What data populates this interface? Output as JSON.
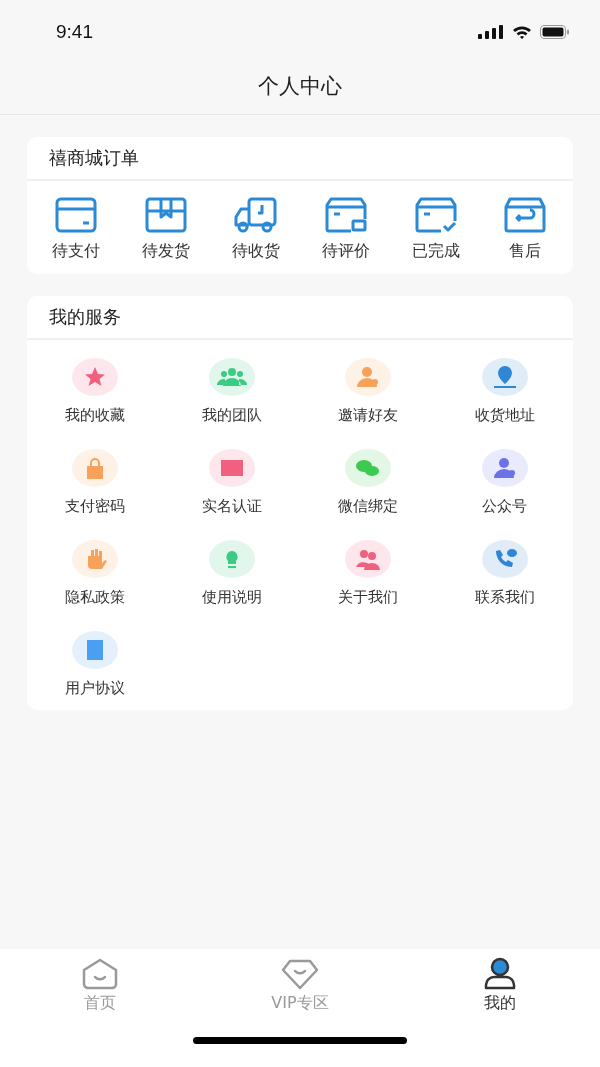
{
  "status_bar": {
    "time": "9:41"
  },
  "header": {
    "title": "个人中心"
  },
  "orders": {
    "title": "禧商城订单",
    "items": [
      {
        "label": "待支付"
      },
      {
        "label": "待发货"
      },
      {
        "label": "待收货"
      },
      {
        "label": "待评价"
      },
      {
        "label": "已完成"
      },
      {
        "label": "售后"
      }
    ]
  },
  "services": {
    "title": "我的服务",
    "items": [
      {
        "label": "我的收藏",
        "color": "#f0607f"
      },
      {
        "label": "我的团队",
        "color": "#3ccb82"
      },
      {
        "label": "邀请好友",
        "color": "#f7a25a"
      },
      {
        "label": "收货地址",
        "color": "#2f86d6"
      },
      {
        "label": "支付密码",
        "color": "#f7a25a"
      },
      {
        "label": "实名认证",
        "color": "#f0607f"
      },
      {
        "label": "微信绑定",
        "color": "#3ccb50"
      },
      {
        "label": "公众号",
        "color": "#6b72e8"
      },
      {
        "label": "隐私政策",
        "color": "#f7a25a"
      },
      {
        "label": "使用说明",
        "color": "#3ccb82"
      },
      {
        "label": "关于我们",
        "color": "#f0607f"
      },
      {
        "label": "联系我们",
        "color": "#2f86d6"
      },
      {
        "label": "用户协议",
        "color": "#4a9ff0"
      }
    ]
  },
  "tab_bar": [
    {
      "label": "首页",
      "selected": false
    },
    {
      "label": "VIP专区",
      "selected": false
    },
    {
      "label": "我的",
      "selected": true
    }
  ]
}
